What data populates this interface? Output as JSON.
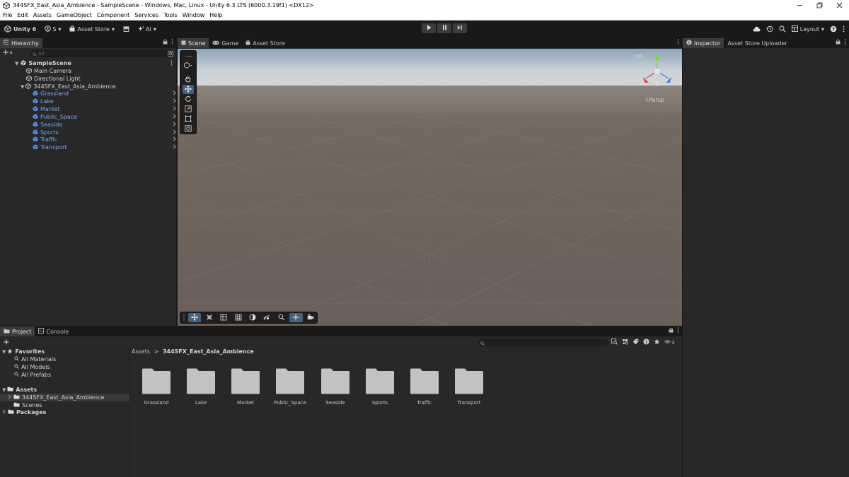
{
  "window": {
    "title": "344SFX_East_Asia_Ambience - SampleScene - Windows, Mac, Linux - Unity 6.3 LTS (6000.3.19f1) <DX12>"
  },
  "menu": [
    "File",
    "Edit",
    "Assets",
    "GameObject",
    "Component",
    "Services",
    "Tools",
    "Window",
    "Help"
  ],
  "toolbar": {
    "unity_label": "Unity 6",
    "account_label": "S",
    "asset_store_label": "Asset Store",
    "ai_label": "AI",
    "layout_label": "Layout"
  },
  "hierarchy": {
    "tab_label": "Hierarchy",
    "search_placeholder": "All",
    "scene_name": "SampleScene",
    "items": [
      {
        "label": "Main Camera"
      },
      {
        "label": "Directional Light"
      },
      {
        "label": "344SFX_East_Asia_Ambience"
      }
    ],
    "children": [
      {
        "label": "Grassland"
      },
      {
        "label": "Lake"
      },
      {
        "label": "Market"
      },
      {
        "label": "Public_Space"
      },
      {
        "label": "Seaside"
      },
      {
        "label": "Sports"
      },
      {
        "label": "Traffic"
      },
      {
        "label": "Transport"
      }
    ]
  },
  "scene": {
    "tabs": [
      "Scene",
      "Game",
      "Asset Store"
    ],
    "persp_label": "Persp"
  },
  "inspector": {
    "tabs": [
      "Inspector",
      "Asset Store Uploader"
    ]
  },
  "project": {
    "tabs": [
      "Project",
      "Console"
    ],
    "favorites_label": "Favorites",
    "favorites": [
      "All Materials",
      "All Models",
      "All Prefabs"
    ],
    "assets_label": "Assets",
    "asset_items": [
      "344SFX_East_Asia_Ambience",
      "Scenes"
    ],
    "packages_label": "Packages",
    "breadcrumb_root": "Assets",
    "breadcrumb_current": "344SFX_East_Asia_Ambience",
    "hidden_count": "3",
    "folders": [
      "Grassland",
      "Lake",
      "Market",
      "Public_Space",
      "Seaside",
      "Sports",
      "Traffic",
      "Transport"
    ]
  },
  "colors": {
    "background": "#282828",
    "toolbar": "#191919",
    "prefab_blue": "#7aa5e6",
    "active_tool": "#46607c"
  }
}
